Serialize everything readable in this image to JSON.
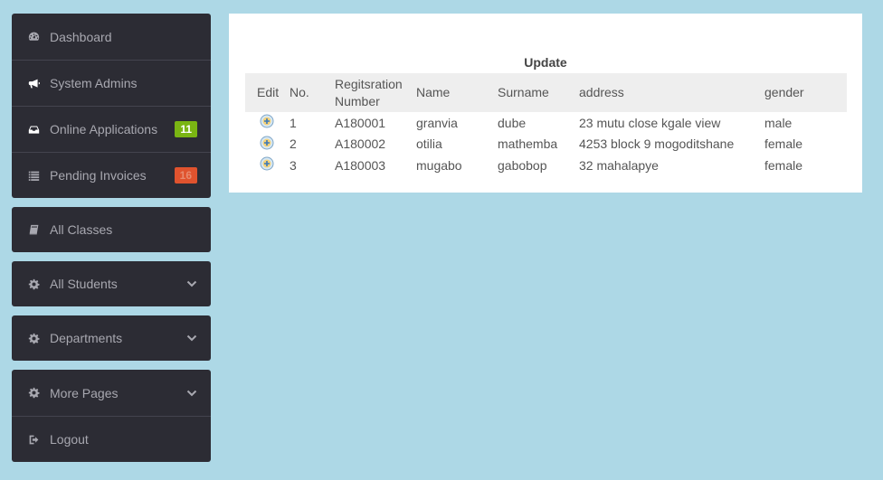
{
  "sidebar": {
    "groups": [
      {
        "items": [
          {
            "label": "Dashboard",
            "icon": "dashboard-icon"
          },
          {
            "label": "System Admins",
            "icon": "megaphone-icon"
          },
          {
            "label": "Online Applications",
            "icon": "inbox-icon",
            "badge": "11",
            "badge_color": "#7ab513"
          },
          {
            "label": "Pending Invoices",
            "icon": "list-icon",
            "badge": "16",
            "badge_color": "#e0532e"
          }
        ]
      },
      {
        "items": [
          {
            "label": "All Classes",
            "icon": "book-icon"
          }
        ]
      },
      {
        "items": [
          {
            "label": "All Students",
            "icon": "gear-icon"
          }
        ]
      },
      {
        "items": [
          {
            "label": "Departments",
            "icon": "gear-icon"
          }
        ]
      },
      {
        "items": [
          {
            "label": "More Pages",
            "icon": "gear-icon"
          },
          {
            "label": "Logout",
            "icon": "sign-out-icon"
          }
        ]
      }
    ]
  },
  "main": {
    "title": "Update",
    "table": {
      "headers": [
        "Edit",
        "No.",
        "Regitsration Number",
        "Name",
        "Surname",
        "address",
        "gender"
      ],
      "rows": [
        {
          "no": "1",
          "reg": "A180001",
          "name": "granvia",
          "surname": "dube",
          "address": "23 mutu close kgale view",
          "gender": "male"
        },
        {
          "no": "2",
          "reg": "A180002",
          "name": "otilia",
          "surname": "mathemba",
          "address": "4253 block 9 mogoditshane",
          "gender": "female"
        },
        {
          "no": "3",
          "reg": "A180003",
          "name": "mugabo",
          "surname": "gabobop",
          "address": "32 mahalapye",
          "gender": "female"
        }
      ]
    }
  },
  "colors": {
    "page_background": "#add8e6",
    "sidebar_background": "#2c2c34",
    "badge_green": "#7ab513",
    "badge_red": "#e0532e"
  }
}
